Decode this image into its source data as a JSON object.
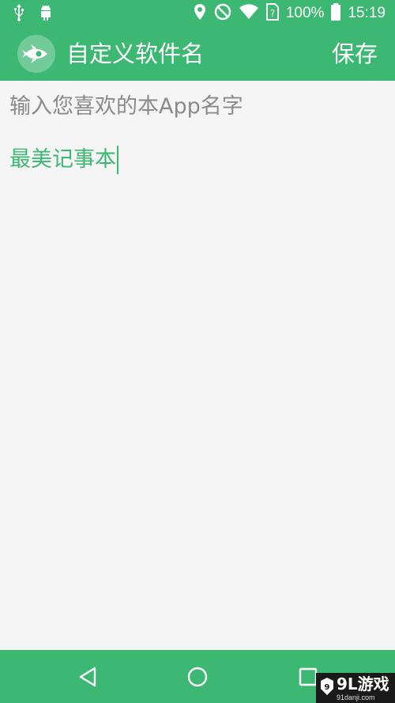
{
  "status_bar": {
    "battery_percent": "100%",
    "time": "15:19",
    "icons": [
      "usb-icon",
      "android-debug-icon",
      "location-icon",
      "do-not-disturb-icon",
      "wifi-icon",
      "sim-unknown-icon",
      "battery-icon"
    ]
  },
  "app_bar": {
    "title": "自定义软件名",
    "save_label": "保存",
    "logo_icon": "rocket-icon"
  },
  "form": {
    "hint": "输入您喜欢的本App名字",
    "name_value": "最美记事本"
  },
  "nav_bar": {
    "buttons": [
      "back-icon",
      "home-icon",
      "recents-icon"
    ]
  },
  "watermark": {
    "text": "9L游戏",
    "site": "91danji.com"
  },
  "colors": {
    "primary": "#3db873",
    "background": "#f5f5f5",
    "hint_text": "#8a8a8a"
  }
}
